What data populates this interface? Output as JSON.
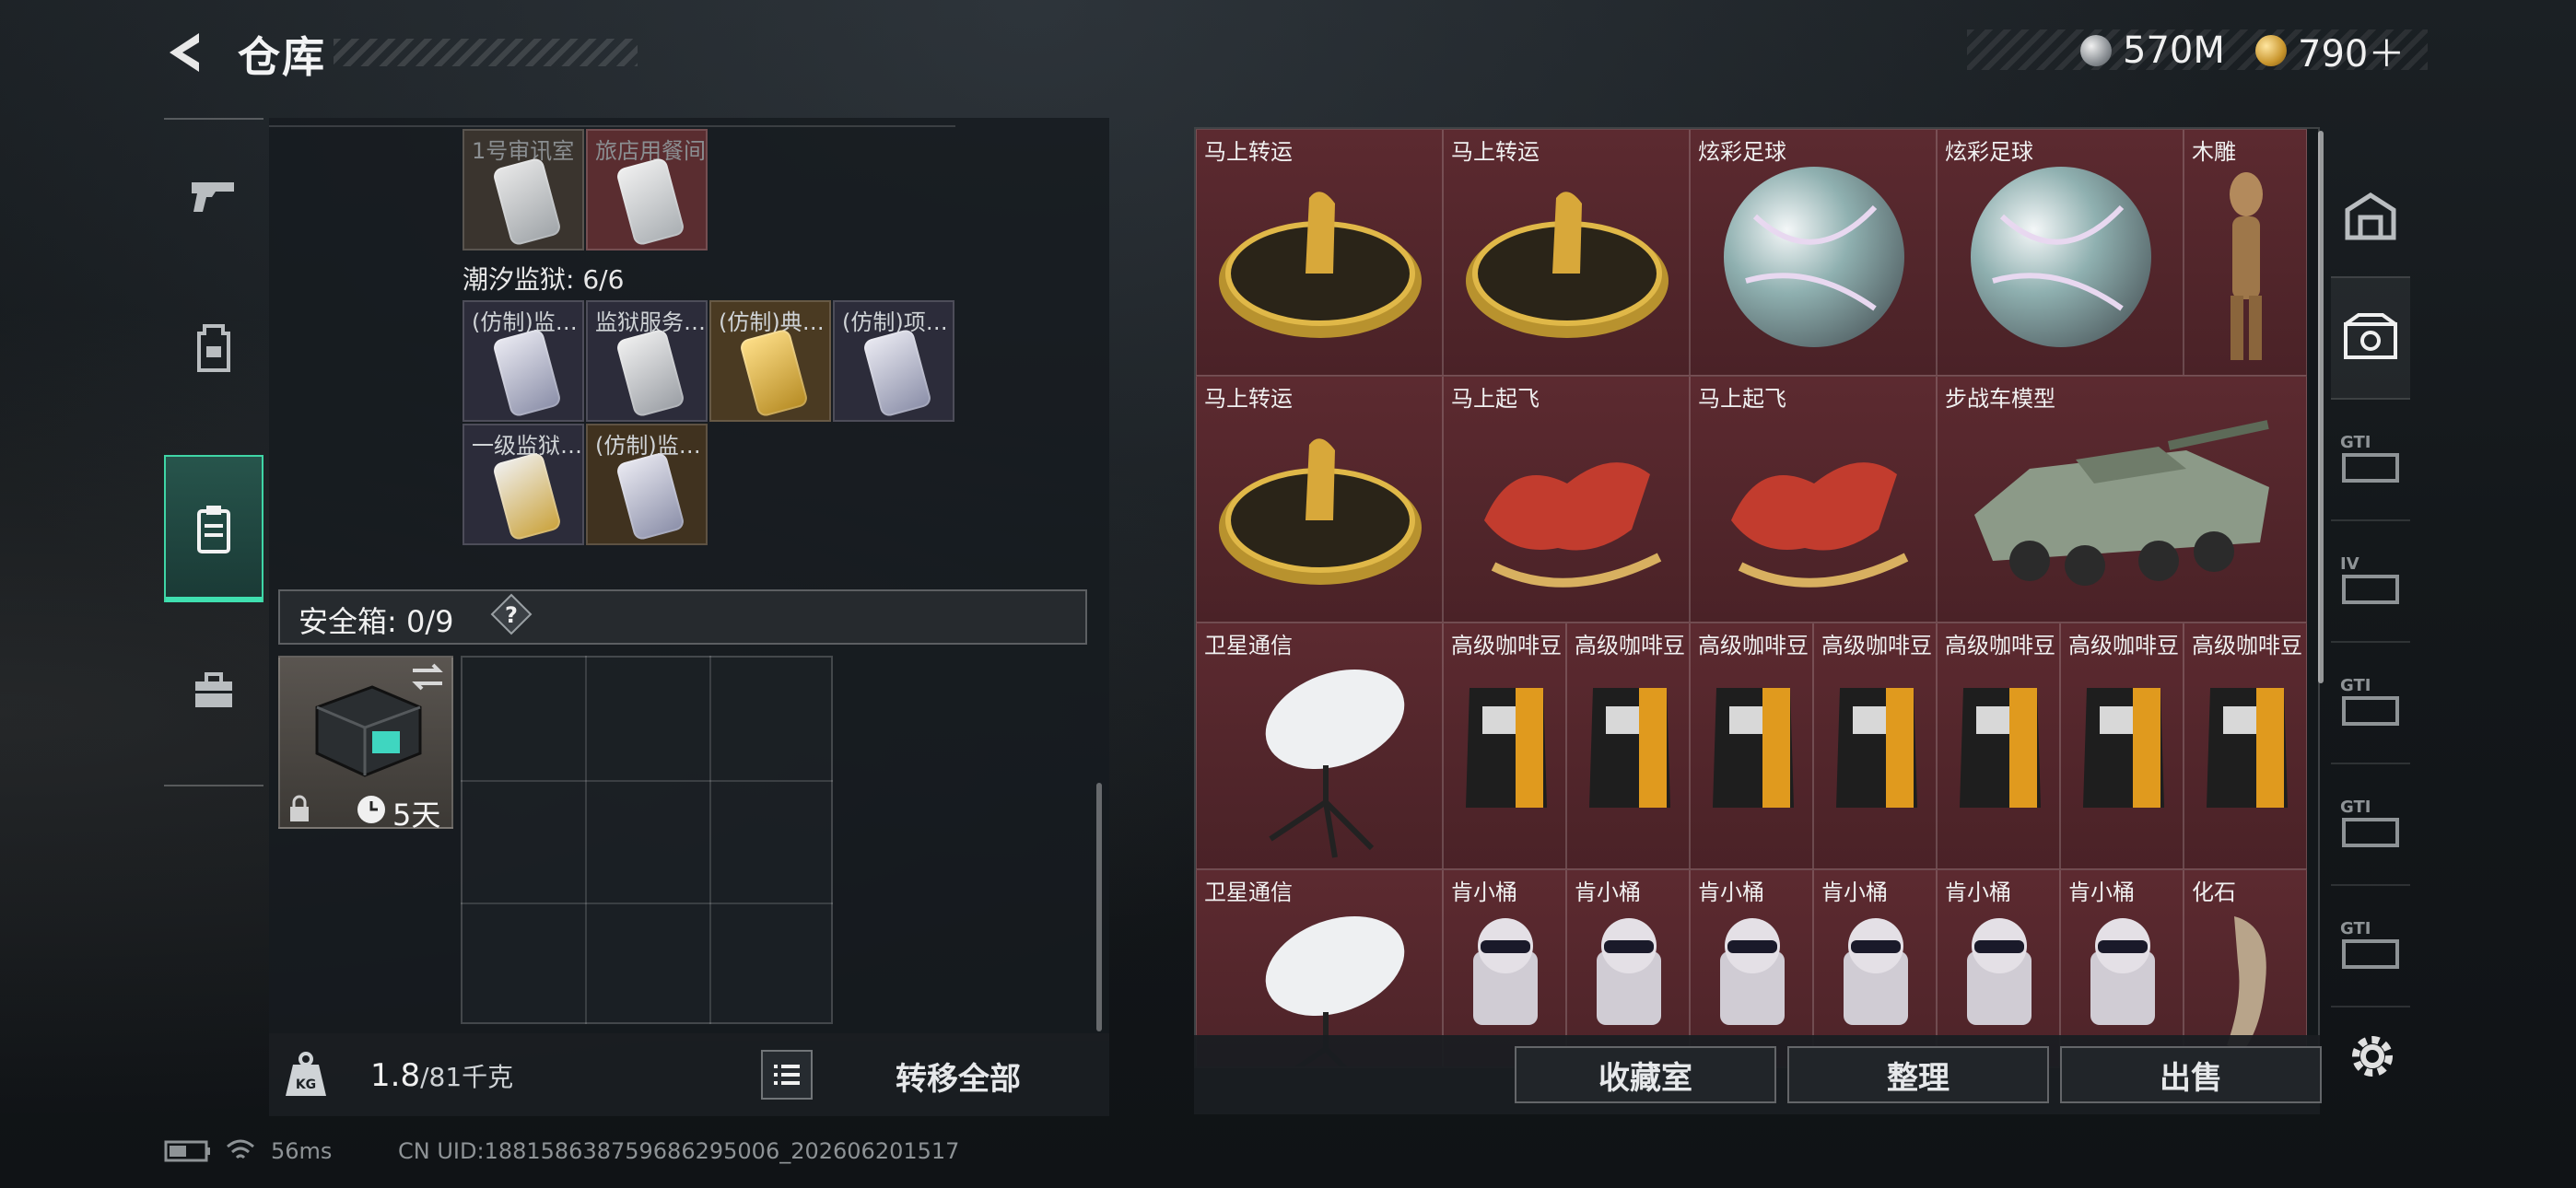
{
  "header": {
    "title": "仓库"
  },
  "currency": {
    "silver": "570M",
    "gold": "790＋"
  },
  "left": {
    "top_items": [
      {
        "label": "1号审讯室",
        "color": "#3a342e"
      },
      {
        "label": "旅店用餐间",
        "color": "#5a2d30"
      }
    ],
    "prison_section": "潮汐监狱: 6/6",
    "prison_items_row1": [
      {
        "label": "(仿制)监…",
        "color": "#2c2c3a"
      },
      {
        "label": "监狱服务…",
        "color": "#2c2c3a"
      },
      {
        "label": "(仿制)典…",
        "color": "#4a3a22"
      },
      {
        "label": "(仿制)项…",
        "color": "#2c2c3a"
      }
    ],
    "prison_items_row2": [
      {
        "label": "一级监狱…",
        "color": "#2c2c3a"
      },
      {
        "label": "(仿制)监…",
        "color": "#40321f"
      }
    ],
    "safe_box_title": "安全箱: 0/9",
    "safe_box_timer": "5天",
    "weight_value": "1.8",
    "weight_cap": "/81千克",
    "transfer_all": "转移全部"
  },
  "stash": {
    "row1": [
      "马上转运",
      "马上转运",
      "炫彩足球",
      "炫彩足球",
      "木雕"
    ],
    "row2": [
      "马上转运",
      "马上起飞",
      "马上起飞",
      "步战车模型"
    ],
    "row3": [
      "卫星通信",
      "高级咖啡豆",
      "高级咖啡豆",
      "高级咖啡豆",
      "高级咖啡豆",
      "高级咖啡豆",
      "高级咖啡豆",
      "高级咖啡豆"
    ],
    "row4": [
      "卫星通信",
      "肯小桶",
      "肯小桶",
      "肯小桶",
      "肯小桶",
      "肯小桶",
      "肯小桶",
      "化石"
    ]
  },
  "actions": {
    "collection": "收藏室",
    "organize": "整理",
    "sell": "出售"
  },
  "right_rail_tabs": [
    "GTI",
    "IV",
    "GTI",
    "GTI",
    "GTI"
  ],
  "status": {
    "ping": "56ms",
    "uid": "CN UID:18815863875968629500​6_202606201517"
  },
  "colors": {
    "accent": "#3fe0b0",
    "stash_bg": "#4f252a"
  }
}
